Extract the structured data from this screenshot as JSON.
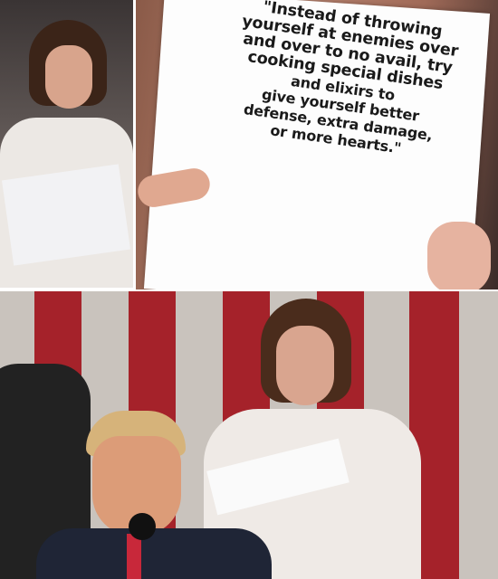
{
  "meme": {
    "top_panel_sign_text_lines": [
      "\"Instead of throwing",
      "yourself at enemies over",
      "and over to no avail, try",
      "cooking special dishes",
      "and elixirs to",
      "give yourself better",
      "defense, extra damage,",
      "or more hearts.\""
    ]
  }
}
